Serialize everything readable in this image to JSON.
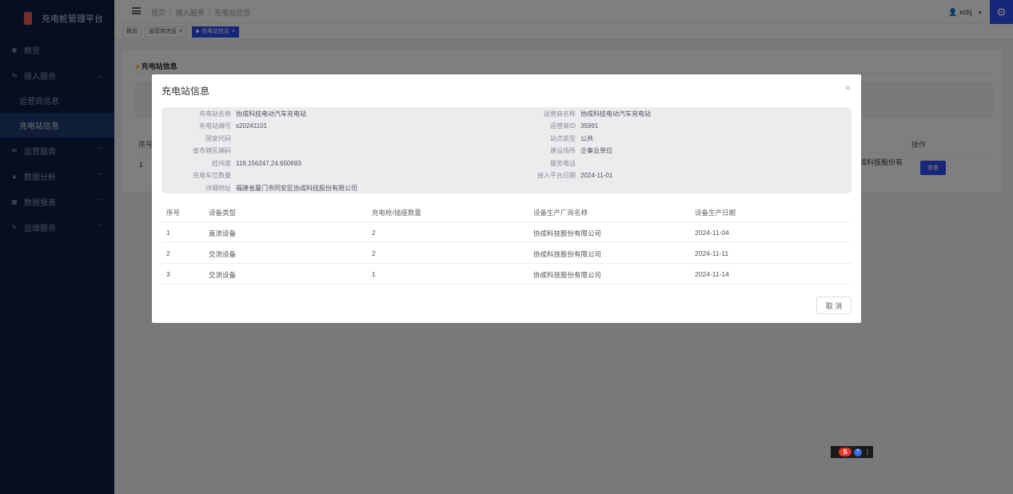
{
  "app": {
    "title": "充电桩管理平台"
  },
  "sidebar": {
    "items": [
      {
        "label": "概览",
        "icon": "dashboard-icon"
      },
      {
        "label": "接入服务",
        "icon": "transfer-icon",
        "expanded": true,
        "children": [
          {
            "label": "运营商信息"
          },
          {
            "label": "充电站信息",
            "active": true
          }
        ]
      },
      {
        "label": "运营服务",
        "icon": "mail-icon"
      },
      {
        "label": "数据分析",
        "icon": "chart-icon"
      },
      {
        "label": "数据报表",
        "icon": "report-icon"
      },
      {
        "label": "运维服务",
        "icon": "tools-icon"
      }
    ]
  },
  "topbar": {
    "breadcrumb": [
      "首页",
      "接入服务",
      "充电站信息"
    ],
    "user": "xckj"
  },
  "tags": [
    {
      "label": "概览"
    },
    {
      "label": "运营商信息"
    },
    {
      "label": "充电站信息",
      "active": true
    }
  ],
  "page": {
    "title": "充电站信息",
    "table_headers": {
      "index": "序号",
      "action": "操作"
    },
    "rows": [
      {
        "index": "1",
        "operator_partial": "成科技股份有",
        "action": "查看"
      }
    ]
  },
  "modal": {
    "title": "充电站信息",
    "close": "×",
    "info_left": [
      {
        "label": "充电站名称",
        "value": "协成科技电动汽车充电站"
      },
      {
        "label": "充电站编号",
        "value": "s20241101"
      },
      {
        "label": "国家代码",
        "value": ""
      },
      {
        "label": "省市辖区编码",
        "value": ""
      },
      {
        "label": "经纬度",
        "value": "118.156247,24.650693"
      },
      {
        "label": "充电车位数量",
        "value": ""
      },
      {
        "label": "详细地址",
        "value": "福建省厦门市同安区协成科技股份有限公司"
      }
    ],
    "info_right": [
      {
        "label": "运营商名称",
        "value": "协成科技电动汽车充电站"
      },
      {
        "label": "运营商ID",
        "value": "35991"
      },
      {
        "label": "站点类型",
        "value": "公共"
      },
      {
        "label": "建设场所",
        "value": "企事业单位"
      },
      {
        "label": "服务电话",
        "value": ""
      },
      {
        "label": "接入平台日期",
        "value": "2024-11-01"
      }
    ],
    "table": {
      "headers": [
        "序号",
        "设备类型",
        "充电枪/插座数量",
        "设备生产厂商名称",
        "设备生产日期"
      ],
      "rows": [
        [
          "1",
          "直流设备",
          "2",
          "协成科技股份有限公司",
          "2024-11-04"
        ],
        [
          "2",
          "交流设备",
          "2",
          "协成科技股份有限公司",
          "2024-11-11"
        ],
        [
          "3",
          "交流设备",
          "1",
          "协成科技股份有限公司",
          "2024-11-14"
        ]
      ]
    },
    "cancel_label": "取 消"
  },
  "widget": {
    "label": "S",
    "help": "?",
    "menu": "⋮"
  }
}
